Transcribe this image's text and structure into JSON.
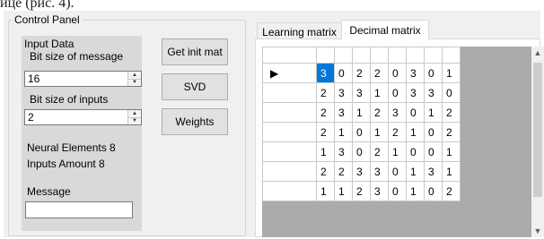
{
  "top_fragment": "ице (рис. 4).",
  "control_panel": {
    "title": "Control Panel",
    "input_data_title": "Input Data",
    "bit_size_message_label": "Bit size of message",
    "bit_size_message_value": "16",
    "bit_size_inputs_label": "Bit size of inputs",
    "bit_size_inputs_value": "2",
    "neural_elements": "Neural Elements 8",
    "inputs_amount": "Inputs Amount 8",
    "message_label": "Message",
    "message_value": ""
  },
  "buttons": {
    "get_init_mat": "Get init mat",
    "svd": "SVD",
    "weights": "Weights"
  },
  "icons": {
    "spin_up": "spin-up-icon",
    "spin_down": "spin-down-icon",
    "row_pointer": "row-pointer-icon",
    "scroll_up": "scroll-up-icon",
    "scroll_down": "scroll-down-icon"
  },
  "tabs": [
    {
      "label": "Learning matrix",
      "active": false
    },
    {
      "label": "Decimal matrix",
      "active": true
    }
  ],
  "grid": {
    "row_indicator": "▶",
    "rows": [
      [
        "3",
        "0",
        "2",
        "2",
        "0",
        "3",
        "0",
        "1"
      ],
      [
        "2",
        "3",
        "3",
        "1",
        "0",
        "3",
        "3",
        "0"
      ],
      [
        "2",
        "3",
        "1",
        "2",
        "3",
        "0",
        "1",
        "2"
      ],
      [
        "2",
        "1",
        "0",
        "1",
        "2",
        "1",
        "0",
        "2"
      ],
      [
        "1",
        "3",
        "0",
        "2",
        "1",
        "0",
        "0",
        "1"
      ],
      [
        "2",
        "2",
        "3",
        "3",
        "0",
        "1",
        "3",
        "1"
      ],
      [
        "1",
        "1",
        "2",
        "3",
        "0",
        "1",
        "0",
        "2"
      ]
    ]
  },
  "colors": {
    "window_bg": "#f0f0f0",
    "panel_bg": "#d9d9d9",
    "selection": "#0078d7",
    "grid_bg": "#ababab"
  }
}
